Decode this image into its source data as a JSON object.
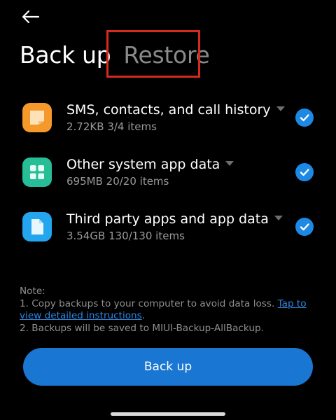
{
  "header": {
    "back_icon": "back-arrow-icon",
    "tabs": [
      {
        "label": "Back up",
        "active": true
      },
      {
        "label": "Restore",
        "active": false
      }
    ],
    "highlight_color": "#d62a1e"
  },
  "items": [
    {
      "icon": "message-icon",
      "color": "#f59a2a",
      "title": "SMS, contacts, and call history",
      "size": "2.72KB",
      "count": "3/4 items",
      "checked": true
    },
    {
      "icon": "apps-grid-icon",
      "color": "#27bd97",
      "title": "Other system app data",
      "size": "695MB",
      "count": "20/20 items",
      "checked": true
    },
    {
      "icon": "file-icon",
      "color": "#23a6ee",
      "title": "Third party apps and app data",
      "size": "3.54GB",
      "count": "130/130 items",
      "checked": true
    }
  ],
  "note": {
    "heading": "Note:",
    "line1_prefix": "1. Copy backups to your computer to avoid data loss. ",
    "line1_link": "Tap to view detailed instructions",
    "line1_suffix": ".",
    "line2": "2. Backups will be saved to MIUI-Backup-AllBackup."
  },
  "button": {
    "label": "Back up"
  },
  "colors": {
    "accent": "#1976d2",
    "check": "#1e88e5",
    "link": "#2f86e0"
  }
}
